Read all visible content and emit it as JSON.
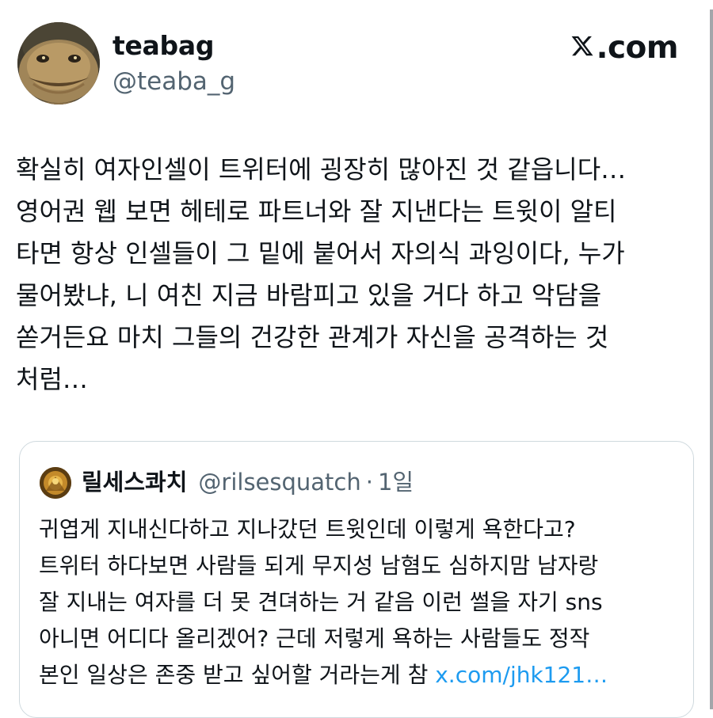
{
  "author": {
    "display_name": "teabag",
    "handle": "@teaba_g"
  },
  "brand": {
    "label": ".com",
    "icon": "x-logo-icon"
  },
  "tweet": {
    "text": "확실히 여자인셀이 트위터에 굉장히 많아진 것 같읍니다…\n영어권 웹 보면 헤테로 파트너와 잘 지낸다는 트윗이 알티\n타면 항상 인셀들이 그 밑에 붙어서 자의식 과잉이다, 누가\n물어봤냐, 니 여친 지금 바람피고 있을 거다 하고 악담을\n쏟거든요 마치 그들의 건강한 관계가 자신을 공격하는 것\n처럼…"
  },
  "quote": {
    "display_name": "릴세스콰치",
    "handle": "@rilsesquatch",
    "separator": "·",
    "time": "1일",
    "text": "귀엽게 지내신다하고 지나갔던 트윗인데 이렇게 욕한다고?\n트위터 하다보면 사람들 되게 무지성 남혐도 심하지맘 남자랑\n잘 지내는 여자를 더 못 견뎌하는 거 같음 이런 썰을 자기 sns\n아니면 어디다 올리겠어? 근데 저렇게 욕하는 사람들도 정작\n본인 일상은 존중 받고 싶어할 거라는게 참 ",
    "link": "x.com/jhk121…"
  },
  "colors": {
    "text": "#0f1419",
    "secondary": "#536471",
    "link": "#1d9bf0",
    "border": "#cfd9de"
  }
}
